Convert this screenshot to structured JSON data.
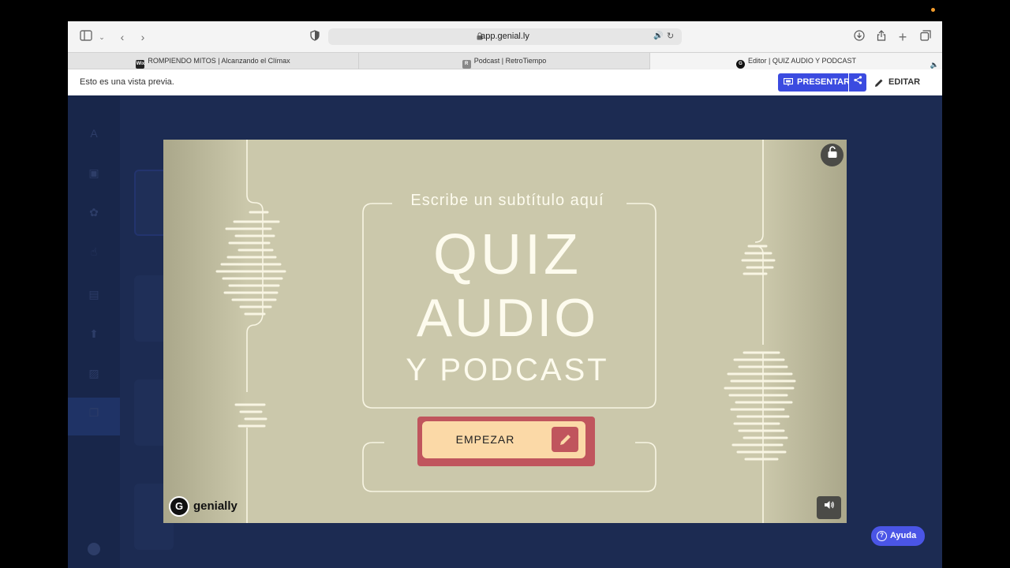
{
  "browser": {
    "url": "app.genial.ly",
    "tabs": [
      {
        "label": "ROMPIENDO MITOS | Alcanzando el Clímax",
        "favicon": "Wix"
      },
      {
        "label": "Podcast | RetroTiempo",
        "favicon": "R"
      },
      {
        "label": "Editor | QUIZ AUDIO Y PODCAST",
        "favicon": "G"
      }
    ]
  },
  "preview": {
    "notice": "Esto es una vista previa.",
    "present_label": "PRESENTAR",
    "edit_label": "EDITAR"
  },
  "slide": {
    "subtitle": "Escribe un subtítulo aquí",
    "title_line1": "QUIZ",
    "title_line2": "AUDIO",
    "title_line3": "Y PODCAST",
    "start_label": "EMPEZAR",
    "brand": "genially"
  },
  "help": {
    "label": "Ayuda"
  },
  "colors": {
    "accent": "#3b4be0",
    "slide_bg": "#cbc8ab",
    "button_red": "#c0555d",
    "button_cream": "#fbd9a7"
  }
}
